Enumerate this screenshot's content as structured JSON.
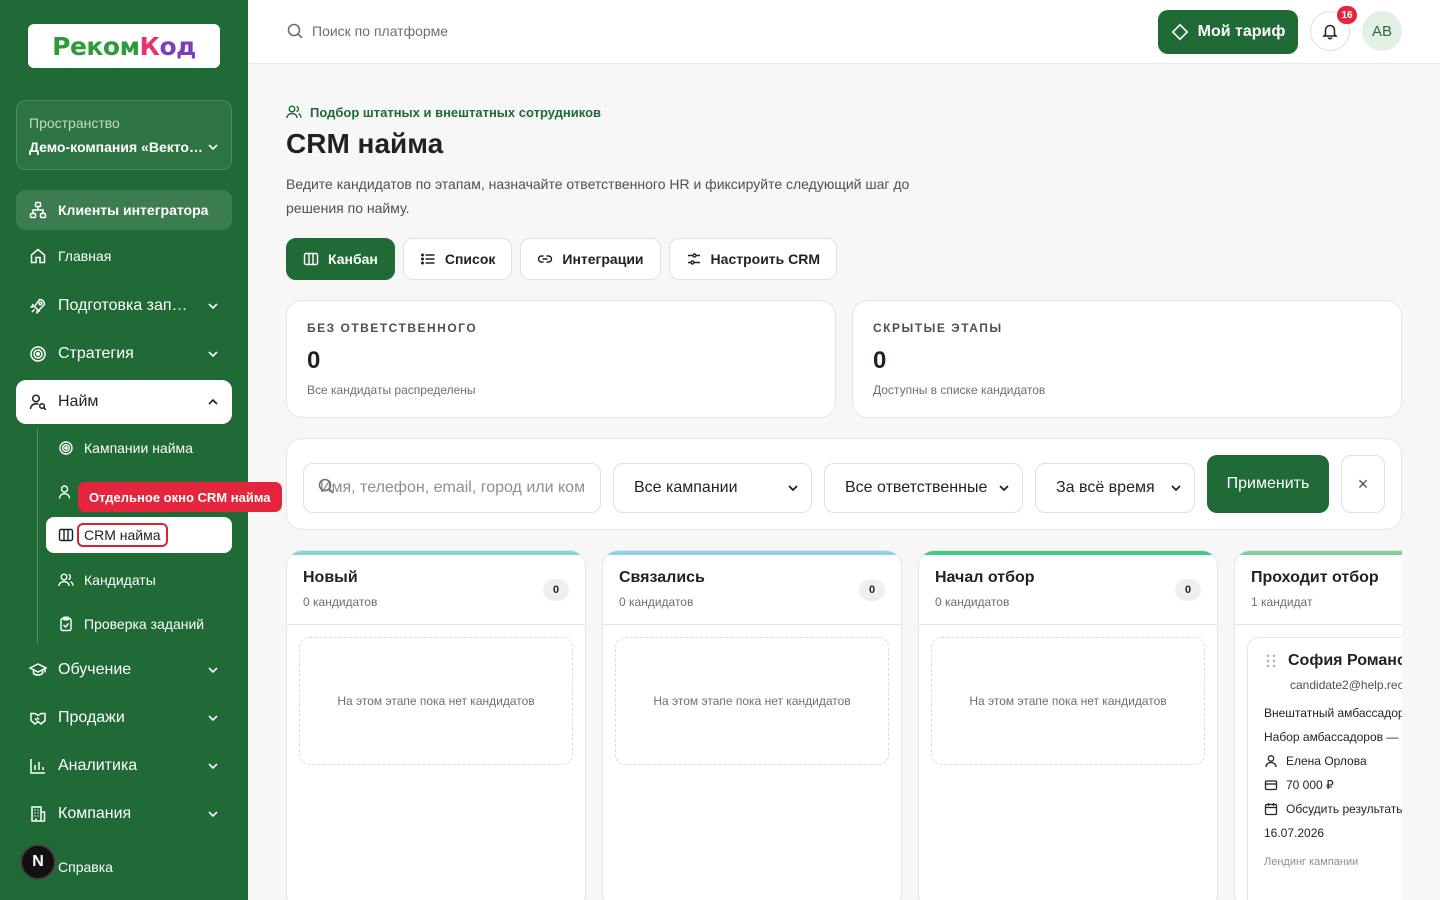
{
  "sidebar": {
    "logo": {
      "part1": "Реком",
      "part2": "К",
      "part3": "од"
    },
    "workspace": {
      "label": "Пространство",
      "name": "Демо-компания «Векто…"
    },
    "clients_label": "Клиенты интегратора",
    "items": [
      {
        "label": "Главная",
        "icon": "home-icon"
      },
      {
        "label": "Подготовка зап…",
        "icon": "rocket-icon"
      },
      {
        "label": "Стратегия",
        "icon": "target-icon"
      },
      {
        "label": "Найм",
        "icon": "user-search-icon"
      },
      {
        "label": "Обучение",
        "icon": "graduation-cap-icon"
      },
      {
        "label": "Продажи",
        "icon": "handshake-icon"
      },
      {
        "label": "Аналитика",
        "icon": "bar-chart-icon"
      },
      {
        "label": "Компания",
        "icon": "building-icon"
      }
    ],
    "sub_items": [
      {
        "label": "Кампании найма",
        "icon": "target-icon"
      },
      {
        "label": "Отдельное окно CRM найма",
        "icon": "user-icon"
      },
      {
        "label": "CRM найма",
        "icon": "columns-icon"
      },
      {
        "label": "Кандидаты",
        "icon": "users-icon"
      },
      {
        "label": "Проверка заданий",
        "icon": "clipboard-icon"
      }
    ],
    "tooltip": "Отдельное окно CRM найма",
    "help": {
      "avatar": "N",
      "label": "Справка"
    }
  },
  "topbar": {
    "search_placeholder": "Поиск по платформе",
    "plan_label": "Мой тариф",
    "notifications_count": "16",
    "user_initials": "АВ"
  },
  "page": {
    "eyebrow": "Подбор штатных и внештатных сотрудников",
    "title": "CRM найма",
    "description": "Ведите кандидатов по этапам, назначайте ответственного HR и фиксируйте следующий шаг до решения по найму.",
    "tabs": [
      {
        "label": "Канбан",
        "icon": "columns-icon"
      },
      {
        "label": "Список",
        "icon": "list-icon"
      },
      {
        "label": "Интеграции",
        "icon": "link-icon"
      },
      {
        "label": "Настроить CRM",
        "icon": "sliders-icon"
      }
    ]
  },
  "stats": [
    {
      "caption": "БЕЗ ОТВЕТСТВЕННОГО",
      "value": "0",
      "note": "Все кандидаты распределены"
    },
    {
      "caption": "СКРЫТЫЕ ЭТАПЫ",
      "value": "0",
      "note": "Доступны в списке кандидатов"
    }
  ],
  "filters": {
    "search_placeholder": "Имя, телефон, email, город или ком",
    "campaign": "Все кампании",
    "owner": "Все ответственные",
    "period": "За всё время",
    "apply_label": "Применить",
    "reset_label": "×"
  },
  "board": {
    "empty_text": "На этом этапе пока нет кандидатов",
    "columns": [
      {
        "title": "Новый",
        "count_text": "0 кандидатов",
        "badge": "0",
        "color": "#7fd8d2"
      },
      {
        "title": "Связались",
        "count_text": "0 кандидатов",
        "badge": "0",
        "color": "#8fd0ea"
      },
      {
        "title": "Начал отбор",
        "count_text": "0 кандидатов",
        "badge": "0",
        "color": "#41c98a"
      },
      {
        "title": "Проходит отбор",
        "count_text": "1 кандидат",
        "badge": "",
        "color": "#7fd19a"
      }
    ],
    "card": {
      "name": "София Романо",
      "email": "candidate2@help.rec",
      "role": "Внештатный амбассадор",
      "campaign": "Набор амбассадоров —",
      "owner": "Елена Орлова",
      "salary": "70 000 ₽",
      "next_step": "Обсудить результать",
      "date": "16.07.2026",
      "source": "Лендинг кампании"
    }
  },
  "colors": {
    "primary": "#1f6a35",
    "accent_red": "#e3263d"
  }
}
